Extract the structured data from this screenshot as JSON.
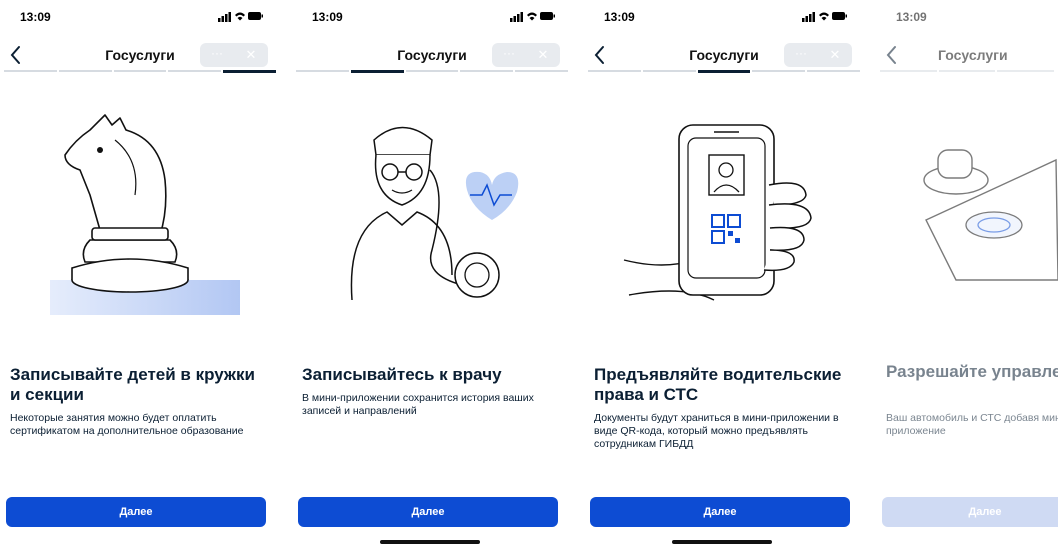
{
  "status_bar": {
    "time": "13:09"
  },
  "app": {
    "title": "Госуслуги",
    "menu_glyph": "···",
    "close_glyph": "✕"
  },
  "slides": [
    {
      "title": "Записывайте детей в кружки и секции",
      "description": "Некоторые занятия можно будет оплатить сертификатом на дополнительное образование",
      "button": "Далее",
      "illustration": "chess-knight"
    },
    {
      "title": "Записывайтесь к врачу",
      "description": "В мини-приложении сохранится история ваших записей и направлений",
      "button": "Далее",
      "illustration": "doctor"
    },
    {
      "title": "Предъявляйте водительские права и СТС",
      "description": "Документы будут храниться в мини-приложении в виде QR-кода, который можно предъявлять сотрудникам ГИБДД",
      "button": "Далее",
      "illustration": "phone-qr"
    },
    {
      "title": "Разрешайте управлен другому водителю",
      "description": "Ваш автомобиль и СТС добавя мини-приложение",
      "button": "Далее",
      "illustration": "stamp"
    }
  ],
  "colors": {
    "primary": "#0d4cd3",
    "primary_disabled": "#a9bdea",
    "text": "#0b1f33",
    "capsule": "#e8ebef"
  }
}
